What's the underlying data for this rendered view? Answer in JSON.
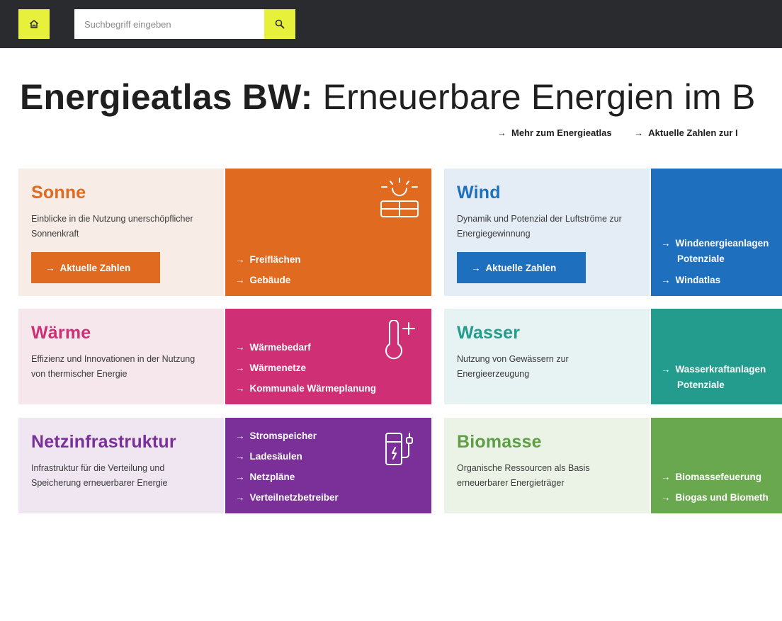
{
  "header": {
    "search_placeholder": "Suchbegriff eingeben",
    "home_icon": "home-icon",
    "search_icon": "search-icon",
    "accent_color": "#e7f03a",
    "bar_color": "#2a2b2f"
  },
  "title": {
    "bold": "Energieatlas BW:",
    "regular": "Erneuerbare Energien im B"
  },
  "top_links": [
    "Mehr zum Energieatlas",
    "Aktuelle Zahlen zur I"
  ],
  "arrow": "→",
  "tiles": {
    "sonne": {
      "title": "Sonne",
      "description": "Einblicke in die Nutzung unerschöpflicher Sonnenkraft",
      "cta": "Aktuelle Zahlen",
      "links": [
        "Freiflächen",
        "Gebäude"
      ],
      "icon": "solar-panel-icon",
      "color": "#e06a1f"
    },
    "wind": {
      "title": "Wind",
      "description": "Dynamik und Potenzial der Luftströme zur Energiegewinnung",
      "cta": "Aktuelle Zahlen",
      "links": [
        "Windenergieanlagen",
        "Potenziale",
        "Windatlas"
      ],
      "color": "#1f6fbf"
    },
    "waerme": {
      "title": "Wärme",
      "description": "Effizienz und Innovationen in der Nutzung von thermischer Energie",
      "links": [
        "Wärmebedarf",
        "Wärmenetze",
        "Kommunale Wärmeplanung"
      ],
      "icon": "thermometer-icon",
      "color": "#cf2f75"
    },
    "wasser": {
      "title": "Wasser",
      "description": "Nutzung von Gewässern zur Energieerzeugung",
      "links": [
        "Wasserkraftanlagen",
        "Potenziale"
      ],
      "color": "#239c8e"
    },
    "netz": {
      "title": "Netzinfrastruktur",
      "description": "Infrastruktur für die Verteilung und Speicherung erneuerbarer Energie",
      "links": [
        "Stromspeicher",
        "Ladesäulen",
        "Netzpläne",
        "Verteilnetzbetreiber"
      ],
      "icon": "charging-station-icon",
      "color": "#7b2f98"
    },
    "biomasse": {
      "title": "Biomasse",
      "description": "Organische Ressourcen als Basis erneuerbarer Energieträger",
      "links": [
        "Biomassefeuerung",
        "Biogas und Biometh"
      ],
      "color": "#6aa84f"
    }
  }
}
